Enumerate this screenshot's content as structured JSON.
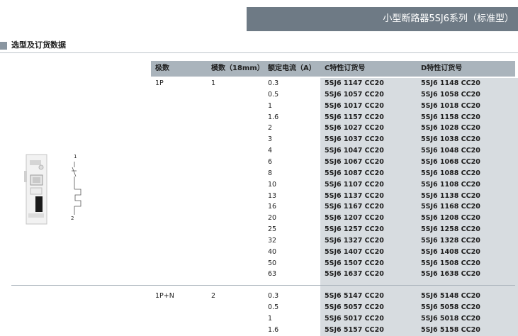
{
  "title": "小型断路器5SJ6系列（标准型）",
  "section": "选型及订货数据",
  "headers": {
    "poles": "极数",
    "modules": "模数（18mm）",
    "current": "额定电流（A）",
    "c_code": "C特性订货号",
    "d_code": "D特性订货号"
  },
  "groups": [
    {
      "poles": "1P",
      "modules": "1",
      "rows": [
        {
          "current": "0.3",
          "c": "5SJ6 1147 CC20",
          "d": "5SJ6 1148 CC20"
        },
        {
          "current": "0.5",
          "c": "5SJ6 1057 CC20",
          "d": "5SJ6 1058 CC20"
        },
        {
          "current": "1",
          "c": "5SJ6 1017 CC20",
          "d": "5SJ6 1018 CC20"
        },
        {
          "current": "1.6",
          "c": "5SJ6 1157 CC20",
          "d": "5SJ6 1158 CC20"
        },
        {
          "current": "2",
          "c": "5SJ6 1027 CC20",
          "d": "5SJ6 1028 CC20"
        },
        {
          "current": "3",
          "c": "5SJ6 1037 CC20",
          "d": "5SJ6 1038 CC20"
        },
        {
          "current": "4",
          "c": "5SJ6 1047 CC20",
          "d": "5SJ6 1048 CC20"
        },
        {
          "current": "6",
          "c": "5SJ6 1067 CC20",
          "d": "5SJ6 1068 CC20"
        },
        {
          "current": "8",
          "c": "5SJ6 1087 CC20",
          "d": "5SJ6 1088 CC20"
        },
        {
          "current": "10",
          "c": "5SJ6 1107 CC20",
          "d": "5SJ6 1108 CC20"
        },
        {
          "current": "13",
          "c": "5SJ6 1137 CC20",
          "d": "5SJ6 1138 CC20"
        },
        {
          "current": "16",
          "c": "5SJ6 1167 CC20",
          "d": "5SJ6 1168 CC20"
        },
        {
          "current": "20",
          "c": "5SJ6 1207 CC20",
          "d": "5SJ6 1208 CC20"
        },
        {
          "current": "25",
          "c": "5SJ6 1257 CC20",
          "d": "5SJ6 1258 CC20"
        },
        {
          "current": "32",
          "c": "5SJ6 1327 CC20",
          "d": "5SJ6 1328 CC20"
        },
        {
          "current": "40",
          "c": "5SJ6 1407 CC20",
          "d": "5SJ6 1408 CC20"
        },
        {
          "current": "50",
          "c": "5SJ6 1507 CC20",
          "d": "5SJ6 1508 CC20"
        },
        {
          "current": "63",
          "c": "5SJ6 1637 CC20",
          "d": "5SJ6 1638 CC20"
        }
      ]
    },
    {
      "poles": "1P+N",
      "modules": "2",
      "rows": [
        {
          "current": "0.3",
          "c": "5SJ6 5147 CC20",
          "d": "5SJ6 5148 CC20"
        },
        {
          "current": "0.5",
          "c": "5SJ6 5057 CC20",
          "d": "5SJ6 5058 CC20"
        },
        {
          "current": "1",
          "c": "5SJ6 5017 CC20",
          "d": "5SJ6 5018 CC20"
        },
        {
          "current": "1.6",
          "c": "5SJ6 5157 CC20",
          "d": "5SJ6 5158 CC20"
        }
      ]
    }
  ],
  "diagram_labels": {
    "top": "1",
    "bottom": "2"
  }
}
